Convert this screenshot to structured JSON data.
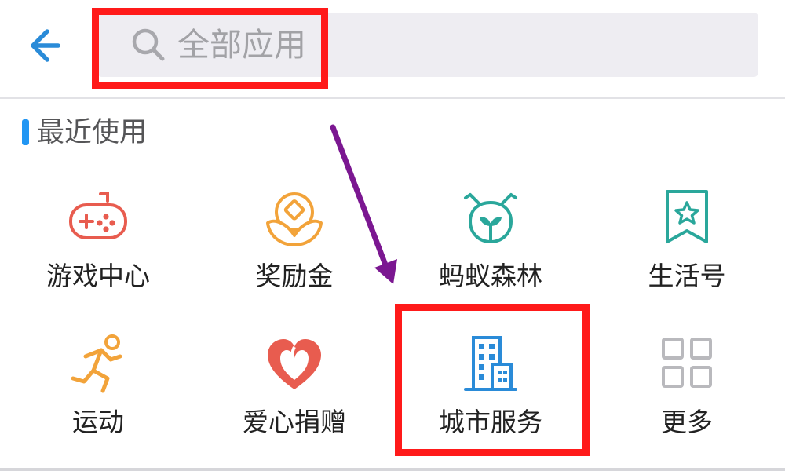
{
  "header": {
    "search_placeholder": "全部应用"
  },
  "section": {
    "title": "最近使用"
  },
  "apps": [
    {
      "label": "游戏中心",
      "icon": "gamepad-icon",
      "color": "#e85c4f"
    },
    {
      "label": "奖励金",
      "icon": "coin-flower-icon",
      "color": "#f2a33a"
    },
    {
      "label": "蚂蚁森林",
      "icon": "sprout-bug-icon",
      "color": "#2aa79b"
    },
    {
      "label": "生活号",
      "icon": "star-bookmark-icon",
      "color": "#2aa79b"
    },
    {
      "label": "运动",
      "icon": "running-icon",
      "color": "#f2a33a"
    },
    {
      "label": "爱心捐赠",
      "icon": "heart-icon",
      "color": "#e85c4f"
    },
    {
      "label": "城市服务",
      "icon": "building-icon",
      "color": "#2a8bd8"
    },
    {
      "label": "更多",
      "icon": "grid-icon",
      "color": "#b9b9bd"
    }
  ],
  "colors": {
    "accent": "#2196f3",
    "annotation_red": "#ff1a1a",
    "annotation_arrow": "#7b1791"
  }
}
